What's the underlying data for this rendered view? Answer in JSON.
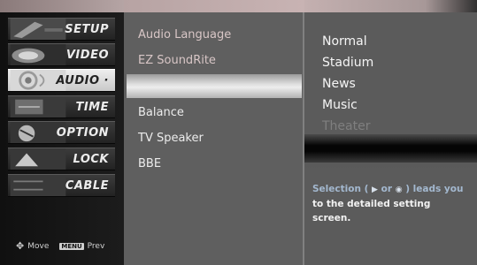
{
  "left_menu": {
    "items": [
      {
        "label": "SETUP"
      },
      {
        "label": "VIDEO"
      },
      {
        "label": "AUDIO"
      },
      {
        "label": "TIME"
      },
      {
        "label": "OPTION"
      },
      {
        "label": "LOCK"
      },
      {
        "label": "CABLE"
      }
    ],
    "active_index": 2,
    "legend": {
      "move_label": "Move",
      "prev_label": "Prev",
      "prev_key": "MENU"
    }
  },
  "audio_menu": {
    "items": [
      {
        "label": "Audio Language"
      },
      {
        "label": "EZ SoundRite"
      },
      {
        "label": ""
      },
      {
        "label": "Balance"
      },
      {
        "label": "TV Speaker"
      },
      {
        "label": "BBE"
      }
    ],
    "highlighted_index": 2
  },
  "options": {
    "items": [
      {
        "label": "Normal"
      },
      {
        "label": "Stadium"
      },
      {
        "label": "News"
      },
      {
        "label": "Music"
      },
      {
        "label": "Theater"
      }
    ]
  },
  "help": {
    "line1_prefix": "Selection (",
    "line1_suffix": ") leads you",
    "line1_or": "or",
    "line2": "to the detailed setting",
    "line3": "screen."
  },
  "colors": {
    "menu_active_bg": "#e6e6e6",
    "panel_bg": "#5f5f5f",
    "help_accent": "#a3b8cf"
  }
}
